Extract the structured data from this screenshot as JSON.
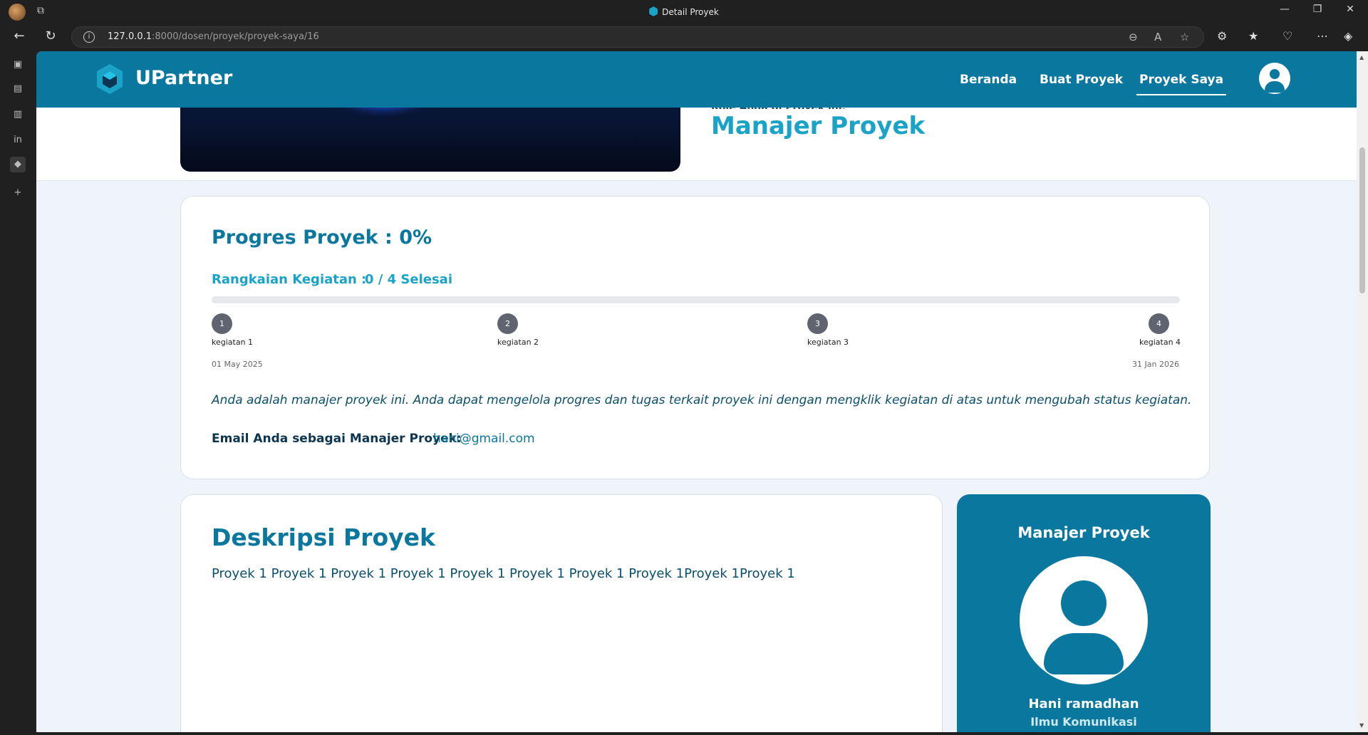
{
  "browser": {
    "tab_title": "Detail Proyek",
    "url_host": "127.0.0.1",
    "url_rest": ":8000/dosen/proyek/proyek-saya/16",
    "window_controls": [
      "—",
      "❐",
      "✕"
    ]
  },
  "navbar": {
    "brand": "UPartner",
    "menu": [
      "Beranda",
      "Buat Proyek",
      "Proyek Saya"
    ],
    "active_menu": "Proyek Saya"
  },
  "hero": {
    "role_caption": "Role Anda di Proyek ini:",
    "role": "Manajer Proyek"
  },
  "progress": {
    "title": "Progres Proyek : 0%",
    "percent": 0,
    "series_label": "Rangkaian Kegiatan :",
    "series_count": "0 / 4 Selesai",
    "steps": [
      {
        "num": "1",
        "name": "kegiatan 1"
      },
      {
        "num": "2",
        "name": "kegiatan 2"
      },
      {
        "num": "3",
        "name": "kegiatan 3"
      },
      {
        "num": "4",
        "name": "kegiatan 4"
      }
    ],
    "start_date": "01 May 2025",
    "end_date": "31 Jan 2026",
    "note": "Anda adalah manajer proyek ini. Anda dapat mengelola progres dan tugas terkait proyek ini dengan mengklik kegiatan di atas untuk mengubah status kegiatan.",
    "email_label": "Email Anda sebagai Manajer Proyek:",
    "email": "hani@gmail.com"
  },
  "description": {
    "title": "Deskripsi Proyek",
    "text": "Proyek 1 Proyek 1 Proyek 1 Proyek 1 Proyek 1 Proyek 1 Proyek 1 Proyek 1Proyek 1Proyek 1"
  },
  "manager": {
    "title": "Manajer Proyek",
    "name": "Hani ramadhan",
    "department": "Ilmu Komunikasi"
  },
  "colors": {
    "primary": "#0a779f",
    "accent": "#1aa3c7"
  }
}
